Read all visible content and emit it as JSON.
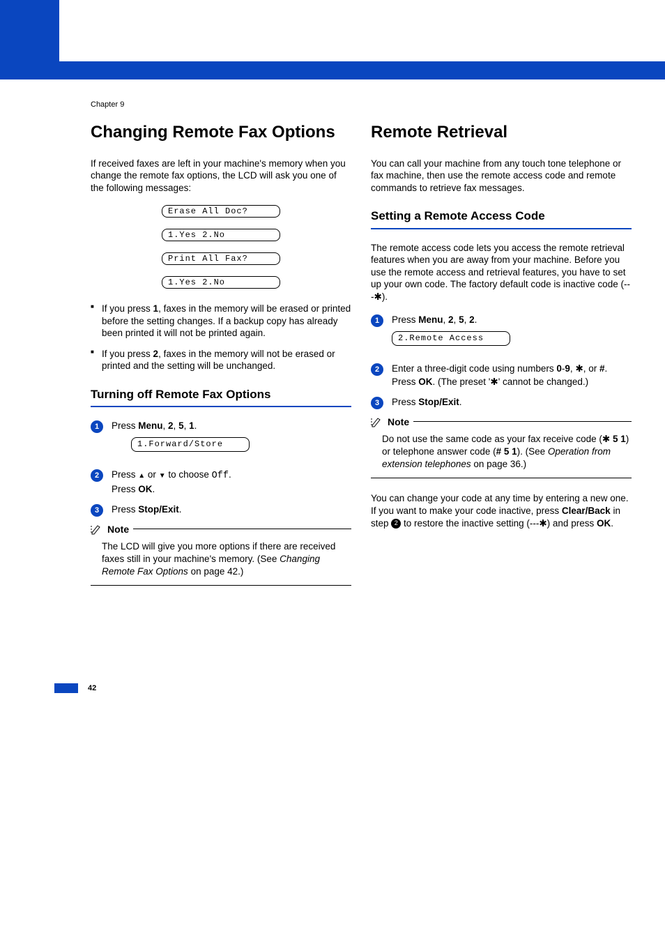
{
  "chapter": "Chapter 9",
  "left": {
    "h1": "Changing Remote Fax Options",
    "intro": "If received faxes are left in your machine's memory when you change the remote fax options, the LCD will ask you one of the following messages:",
    "lcd": [
      "Erase All Doc?",
      "1.Yes 2.No",
      "Print All Fax?",
      "1.Yes 2.No"
    ],
    "bullets": [
      {
        "pre": "If you press ",
        "bold": "1",
        "post": ", faxes in the memory will be erased or printed before the setting changes. If a backup copy has already been printed it will not be printed again."
      },
      {
        "pre": "If you press ",
        "bold": "2",
        "post": ", faxes in the memory will not be erased or printed and the setting will be unchanged."
      }
    ],
    "h2": "Turning off Remote Fax Options",
    "steps": {
      "s1": {
        "label": "1",
        "pre": "Press ",
        "b1": "Menu",
        "mid": ", ",
        "b2": "2",
        "mid2": ", ",
        "b3": "5",
        "mid3": ", ",
        "b4": "1",
        "post": "."
      },
      "s1_lcd": "1.Forward/Store",
      "s2": {
        "label": "2",
        "text_a": "Press ",
        "text_b": " or ",
        "text_c": " to choose ",
        "off": "Off",
        "post": ".",
        "line2a": "Press ",
        "line2b": "OK",
        "line2c": "."
      },
      "s3": {
        "label": "3",
        "pre": "Press ",
        "b": "Stop/Exit",
        "post": "."
      }
    },
    "note_title": "Note",
    "note_body_a": "The LCD will give you more options if there are received faxes still in your machine's memory. (See ",
    "note_body_italic": "Changing Remote Fax Options",
    "note_body_b": " on page 42.)"
  },
  "right": {
    "h1": "Remote Retrieval",
    "intro": "You can call your machine from any touch tone telephone or fax machine, then use the remote access code and remote commands to retrieve fax messages.",
    "h2": "Setting a Remote Access Code",
    "para": "The remote access code lets you access the remote retrieval features when you are away from your machine. Before you use the remote access and retrieval features, you have to set up your own code. The factory default code is inactive code (---",
    "para_post": ").",
    "steps": {
      "s1": {
        "label": "1",
        "pre": "Press ",
        "b1": "Menu",
        "m1": ", ",
        "b2": "2",
        "m2": ", ",
        "b3": "5",
        "m3": ", ",
        "b4": "2",
        "post": "."
      },
      "s1_lcd": "2.Remote Access",
      "s2": {
        "label": "2",
        "l1_a": "Enter a three-digit code using numbers ",
        "b0": "0",
        "dash": "-",
        "b9": "9",
        "c1": ", ",
        "star": "✱",
        "c2": ", or ",
        "bhash": "#",
        "post1": ".",
        "l2a": "Press ",
        "l2b": "OK",
        "l2c": ". (The preset '",
        "l2d": "' cannot be changed.)"
      },
      "s3": {
        "label": "3",
        "pre": "Press ",
        "b": "Stop/Exit",
        "post": "."
      }
    },
    "note_title": "Note",
    "note_body_a": "Do not use the same code as your fax receive code (",
    "note_body_b": " 5 1",
    "note_body_c": ") or telephone answer code (",
    "note_body_d": "# 5 1",
    "note_body_e": "). (See ",
    "note_body_italic": "Operation from extension telephones",
    "note_body_f": " on page 36.)",
    "closing_a": "You can change your code at any time by entering a new one. If you want to make your code inactive, press ",
    "closing_b": "Clear/Back",
    "closing_c": " in step ",
    "closing_circle": "2",
    "closing_d": " to restore the inactive setting (---",
    "closing_e": ") and press ",
    "closing_f": "OK",
    "closing_g": "."
  },
  "page_number": "42"
}
